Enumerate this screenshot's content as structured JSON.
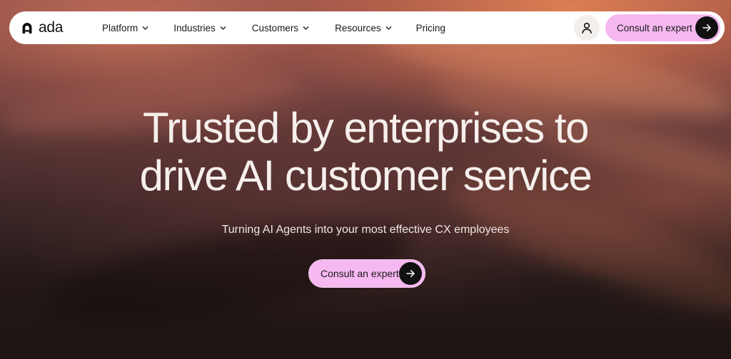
{
  "brand": {
    "name": "ada",
    "logo_icon": "ada-logo-mark"
  },
  "nav": {
    "items": [
      {
        "label": "Platform",
        "has_dropdown": true
      },
      {
        "label": "Industries",
        "has_dropdown": true
      },
      {
        "label": "Customers",
        "has_dropdown": true
      },
      {
        "label": "Resources",
        "has_dropdown": true
      },
      {
        "label": "Pricing",
        "has_dropdown": false
      }
    ],
    "account_icon": "user-icon",
    "cta_label": "Consult an expert",
    "cta_icon": "arrow-right-icon"
  },
  "hero": {
    "headline_line1": "Trusted by enterprises to",
    "headline_line2": "drive AI customer service",
    "subheadline": "Turning AI Agents into your most effective CX employees",
    "cta_label": "Consult an expert",
    "cta_icon": "arrow-right-icon"
  },
  "colors": {
    "cta_pink": "#f5b8f0",
    "arrow_circle": "#111111",
    "navbar_bg": "#ffffff",
    "headline_text": "#f6efec"
  }
}
